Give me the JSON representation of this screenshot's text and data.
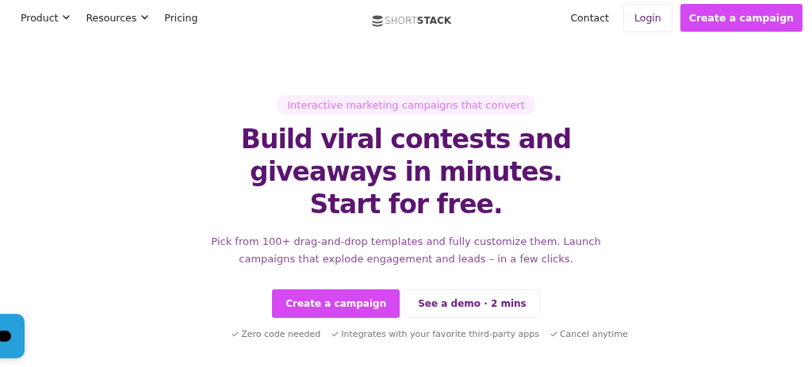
{
  "nav": {
    "items": [
      {
        "label": "Product",
        "dropdown": true
      },
      {
        "label": "Resources",
        "dropdown": true
      },
      {
        "label": "Pricing",
        "dropdown": false
      }
    ],
    "logo": "SHORT**STACK**",
    "contact": "Contact",
    "login": "Login",
    "cta": "Create a campaign"
  },
  "hero": {
    "badge": "Interactive marketing campaigns that convert",
    "headline": [
      "Build viral contests and",
      "giveaways in minutes.",
      "Start for free."
    ],
    "subtitle": "Pick from 100+ drag-and-drop templates and fully customize them. Launch campaigns that explode engagement and leads – in a few clicks.",
    "primary_button": "Create a campaign",
    "secondary_button": {
      "label": "See a demo",
      "separator": "·",
      "duration": "2 mins"
    },
    "features": [
      "Zero code needed",
      "Integrates with your favorite third-party apps",
      "Cancel anytime"
    ]
  }
}
